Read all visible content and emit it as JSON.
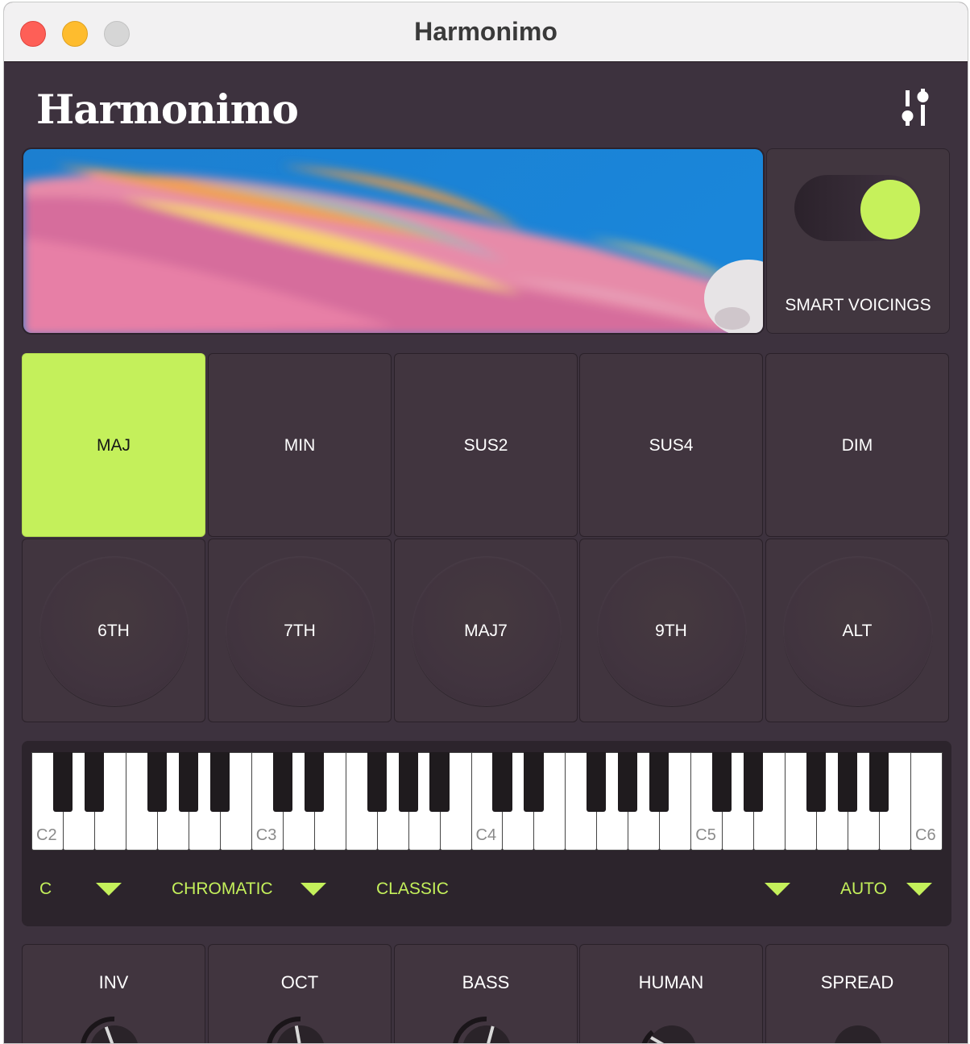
{
  "window": {
    "title": "Harmonimo"
  },
  "brand": {
    "name": "Harmonimo"
  },
  "smart_voicings": {
    "label": "SMART VOICINGS",
    "enabled": true,
    "accent": "#c6f15b"
  },
  "chord_pads": [
    {
      "label": "MAJ",
      "active": true
    },
    {
      "label": "MIN",
      "active": false
    },
    {
      "label": "SUS2",
      "active": false
    },
    {
      "label": "SUS4",
      "active": false
    },
    {
      "label": "DIM",
      "active": false
    }
  ],
  "extension_pads": [
    {
      "label": "6TH"
    },
    {
      "label": "7TH"
    },
    {
      "label": "MAJ7"
    },
    {
      "label": "9TH"
    },
    {
      "label": "ALT"
    }
  ],
  "keyboard": {
    "octave_labels": [
      "C2",
      "C3",
      "C4",
      "C5",
      "C6"
    ]
  },
  "controls": {
    "key": "C",
    "scale": "CHROMATIC",
    "voicing_style": "CLASSIC",
    "mode": "AUTO"
  },
  "knobs": [
    {
      "label": "INV"
    },
    {
      "label": "OCT"
    },
    {
      "label": "BASS"
    },
    {
      "label": "HUMAN"
    },
    {
      "label": "SPREAD"
    }
  ]
}
